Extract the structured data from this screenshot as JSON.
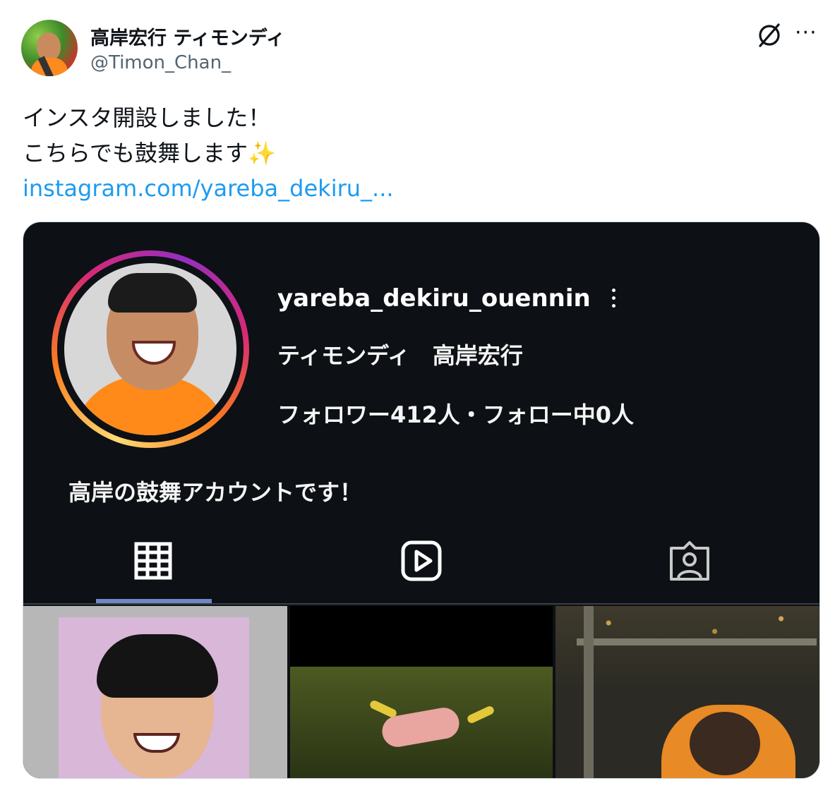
{
  "author": {
    "display_name": "高岸宏行 ティモンディ",
    "handle": "@Timon_Chan_"
  },
  "actions": {
    "grok_icon": "grok-icon",
    "more_icon": "more-icon",
    "more_label": "···"
  },
  "tweet": {
    "text": "インスタ開設しました！\nこちらでも鼓舞します✨",
    "link": "instagram.com/yareba_dekiru_..."
  },
  "instagram": {
    "username": "yareba_dekiru_ouennin",
    "full_name": "ティモンディ　高岸宏行",
    "stats": "フォロワー412人・フォロー中0人",
    "bio": "高岸の鼓舞アカウントです！",
    "tabs": [
      {
        "icon": "grid-icon",
        "active": true
      },
      {
        "icon": "reels-icon",
        "active": false
      },
      {
        "icon": "tagged-icon",
        "active": false
      }
    ]
  },
  "colors": {
    "link": "#1d9bf0",
    "card_bg": "#0d1014",
    "tab_indicator": "#6f86c7"
  }
}
